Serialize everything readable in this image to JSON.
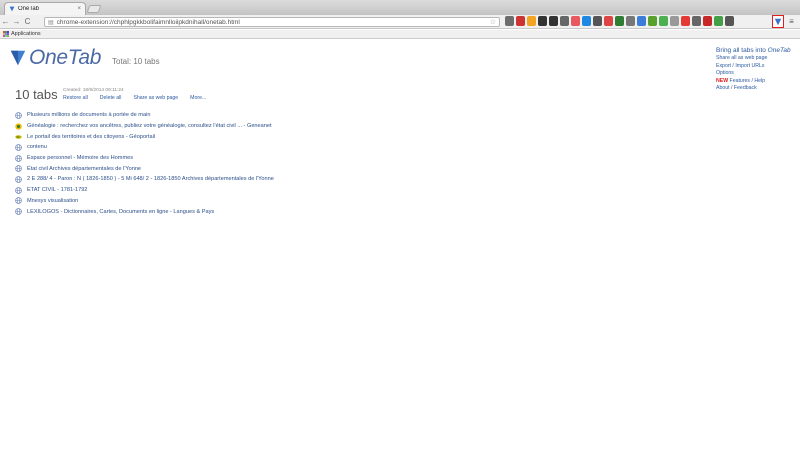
{
  "browser": {
    "tab_title": "OneTab",
    "tab_close": "×",
    "nav": {
      "back": "←",
      "forward": "→",
      "reload": "C"
    },
    "address": "chrome-extension://chphlpgkkbolifaimnlloiipkdnihall/onetab.html",
    "bookmarks_label": "Applications",
    "extension_labels": [
      "",
      "",
      "",
      "",
      "",
      "",
      "",
      "",
      "",
      "",
      "",
      "",
      "",
      "",
      "",
      "",
      "",
      "",
      "",
      "",
      ""
    ],
    "extension_colors": [
      "#6d6d6d",
      "#c33",
      "#f3a521",
      "#333",
      "#333",
      "#666",
      "#e9575f",
      "#1e88e5",
      "#555",
      "#d44",
      "#2e7d32",
      "#777",
      "#3b7dd8",
      "#5aa02c",
      "#4caf50",
      "#999",
      "#e53935",
      "#666",
      "#c62828",
      "#43a047",
      "#555"
    ]
  },
  "onetab": {
    "logo_text": "OneTab",
    "total": "Total: 10 tabs",
    "right_menu": {
      "bring_all_prefix": "Bring all tabs into ",
      "bring_all_brand": "OneTab",
      "share_all": "Share all as web page",
      "export_import": "Export / Import URLs",
      "options": "Options",
      "new_badge": "NEW",
      "features_help": " Features / Help",
      "about": "About / Feedback"
    },
    "group": {
      "count": "10 tabs",
      "created": "Created: 18/9/2014 09:11:24",
      "actions": {
        "restore": "Restore all",
        "delete": "Delete all",
        "share": "Share as web page",
        "more": "More..."
      }
    },
    "tabs": [
      {
        "title": "Plusieurs millions de documents à portée de main",
        "favicon": "globe-icon"
      },
      {
        "title": "Généalogie : recherchez vos ancêtres, publiez votre généalogie, consultez l'état civil ... - Geneanet",
        "favicon": "geneanet-icon"
      },
      {
        "title": "Le portail des territoires et des citoyens - Géoportail",
        "favicon": "geoportail-icon"
      },
      {
        "title": "contenu",
        "favicon": "globe-icon"
      },
      {
        "title": "Espace personnel - Mémoire des Hommes",
        "favicon": "globe-icon"
      },
      {
        "title": "État civil Archives départementales de l'Yonne",
        "favicon": "globe-icon"
      },
      {
        "title": "2 E 288/ 4 - Paron : N ( 1826-1850 ) - 5 Mi 648/ 2 - 1826-1850 Archives départementales de l'Yonne",
        "favicon": "globe-icon"
      },
      {
        "title": "ETAT CIVIL - 1781-1792",
        "favicon": "globe-icon"
      },
      {
        "title": "Mnesys visualisation",
        "favicon": "globe-icon"
      },
      {
        "title": "LEXILOGOS - Dictionnaires, Cartes, Documents en ligne - Langues & Pays",
        "favicon": "globe-icon"
      }
    ]
  },
  "colors": {
    "link": "#2c4f8a",
    "brand": "#4a6aa5",
    "highlight": "#e02020"
  }
}
